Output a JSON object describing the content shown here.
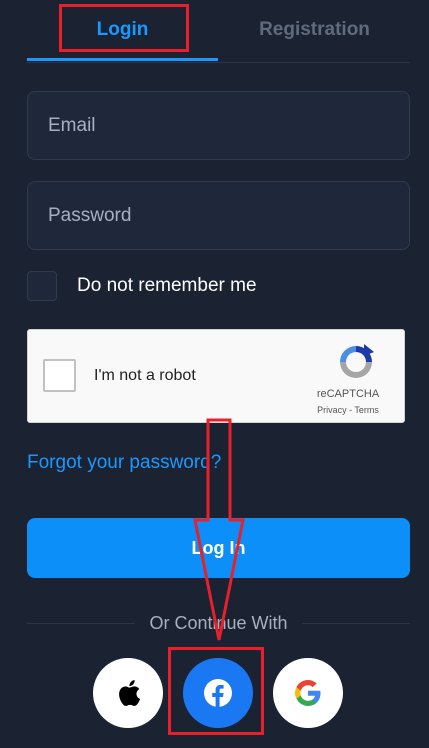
{
  "tabs": {
    "login": "Login",
    "registration": "Registration"
  },
  "form": {
    "email_placeholder": "Email",
    "password_placeholder": "Password",
    "remember_label": "Do not remember me",
    "forgot_link": "Forgot your password?",
    "login_button": "Log In"
  },
  "recaptcha": {
    "label": "I'm not a robot",
    "brand": "reCAPTCHA",
    "links": "Privacy - Terms"
  },
  "social": {
    "divider_text": "Or Continue With",
    "providers": [
      "apple-icon",
      "facebook-icon",
      "google-icon"
    ]
  },
  "colors": {
    "background": "#1b2332",
    "accent": "#1a98ff",
    "button": "#0c8ff8",
    "facebook": "#1a78f2",
    "annotation": "#e8202a"
  }
}
